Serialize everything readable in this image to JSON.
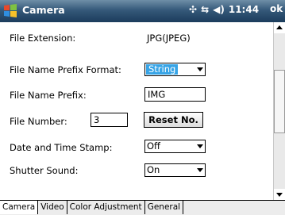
{
  "titlebar": {
    "title": "Camera",
    "time": "11:44",
    "ok": "ok",
    "icons": [
      "windows-start-icon",
      "signal-icon",
      "connectivity-icon",
      "speaker-icon"
    ]
  },
  "settings": {
    "file_extension": {
      "label": "File Extension:",
      "value": "JPG(JPEG)"
    },
    "prefix_format": {
      "label": "File Name Prefix Format:",
      "value": "String"
    },
    "prefix": {
      "label": "File Name Prefix:",
      "value": "IMG"
    },
    "file_number": {
      "label": "File Number:",
      "value": "3",
      "reset_label": "Reset No."
    },
    "timestamp": {
      "label": "Date and Time Stamp:",
      "value": "Off"
    },
    "shutter": {
      "label": "Shutter Sound:",
      "value": "On"
    }
  },
  "tabs": [
    "Camera",
    "Video",
    "Color Adjustment",
    "General"
  ]
}
